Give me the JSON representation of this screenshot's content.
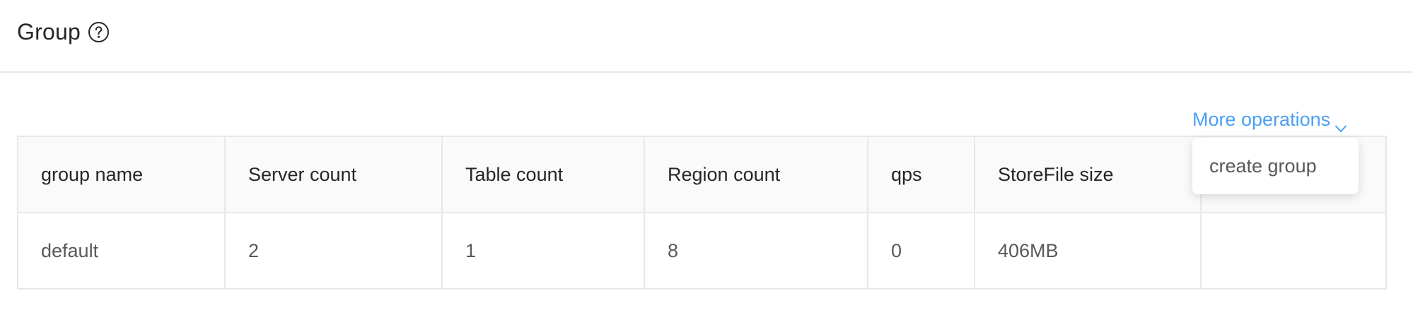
{
  "header": {
    "title": "Group",
    "help_icon": "question-circle-icon"
  },
  "toolbar": {
    "more_operations_label": "More operations",
    "chevron_icon": "chevron-down-icon"
  },
  "dropdown": {
    "items": [
      {
        "label": "create group"
      }
    ]
  },
  "table": {
    "columns": [
      "group name",
      "Server count",
      "Table count",
      "Region count",
      "qps",
      "StoreFile size",
      ""
    ],
    "rows": [
      [
        "default",
        "2",
        "1",
        "8",
        "0",
        "406MB",
        ""
      ]
    ]
  },
  "colors": {
    "accent": "#4a9ff5",
    "border": "#e8e8e8",
    "header_bg": "#fafafa"
  }
}
